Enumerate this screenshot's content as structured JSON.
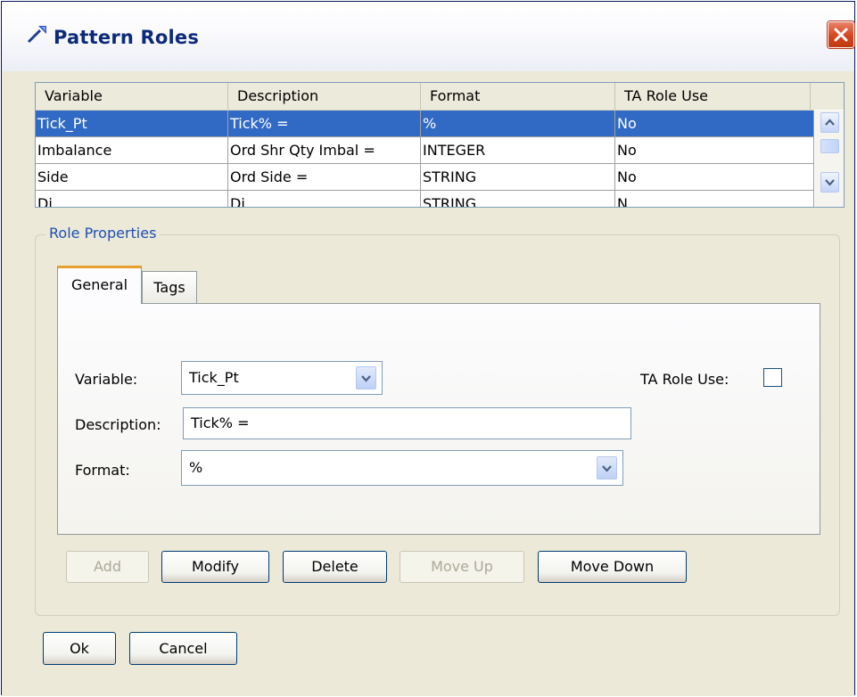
{
  "window": {
    "title": "Pattern Roles"
  },
  "table": {
    "columns": [
      "Variable",
      "Description",
      "Format",
      "TA Role Use"
    ],
    "rows": [
      {
        "variable": "Tick_Pt",
        "description": "Tick% =",
        "format": "%",
        "ta_role_use": "No"
      },
      {
        "variable": "Imbalance",
        "description": "Ord Shr Qty Imbal =",
        "format": "INTEGER",
        "ta_role_use": "No"
      },
      {
        "variable": "Side",
        "description": "Ord Side =",
        "format": "STRING",
        "ta_role_use": "No"
      },
      {
        "variable": "Di...",
        "description": "Di...",
        "format": "STRING",
        "ta_role_use": "N..."
      }
    ],
    "selected_row": 0
  },
  "role_properties": {
    "legend": "Role Properties",
    "tabs": [
      "General",
      "Tags"
    ],
    "active_tab": "General",
    "variable_label": "Variable:",
    "variable_value": "Tick_Pt",
    "description_label": "Description:",
    "description_value": "Tick% =",
    "format_label": "Format:",
    "format_value": "%",
    "ta_role_use_label": "TA Role Use:",
    "ta_role_use_checked": false
  },
  "actions": {
    "add": "Add",
    "modify": "Modify",
    "delete": "Delete",
    "move_up": "Move Up",
    "move_down": "Move Down",
    "add_enabled": false,
    "move_up_enabled": false
  },
  "footer": {
    "ok": "Ok",
    "cancel": "Cancel"
  },
  "colors": {
    "selection": "#316ac5",
    "title_text": "#0c2a7a",
    "group_legend": "#1e50b4",
    "close_button": "#d4461f"
  },
  "icons": {
    "title": "pattern-wand-icon",
    "close": "close-icon",
    "scroll_up": "chevron-up-icon",
    "scroll_down": "chevron-down-icon",
    "combo": "chevron-down-icon"
  }
}
